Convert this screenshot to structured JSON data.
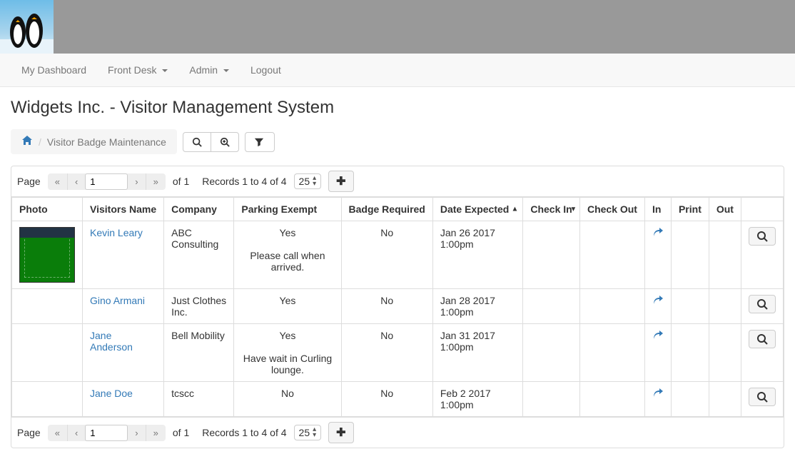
{
  "nav": {
    "items": [
      {
        "label": "My Dashboard",
        "dropdown": false
      },
      {
        "label": "Front Desk",
        "dropdown": true
      },
      {
        "label": "Admin",
        "dropdown": true
      },
      {
        "label": "Logout",
        "dropdown": false
      }
    ]
  },
  "page_title": "Widgets Inc. - Visitor Management System",
  "breadcrumb": {
    "current": "Visitor Badge Maintenance"
  },
  "pager": {
    "page_label": "Page",
    "page_value": "1",
    "of_label": "of",
    "total_pages": "1",
    "records_text": "Records 1 to 4 of 4",
    "page_size": "25"
  },
  "columns": {
    "photo": "Photo",
    "name": "Visitors Name",
    "company": "Company",
    "parking": "Parking Exempt",
    "badge": "Badge Required",
    "date": "Date Expected",
    "checkin": "Check In",
    "checkout": "Check Out",
    "in": "In",
    "print": "Print",
    "out": "Out"
  },
  "rows": [
    {
      "has_photo": true,
      "name": "Kevin Leary",
      "company": "ABC Consulting",
      "parking": "Yes",
      "parking_note": "Please call when arrived.",
      "badge": "No",
      "date": "Jan 26 2017 1:00pm"
    },
    {
      "has_photo": false,
      "name": "Gino Armani",
      "company": "Just Clothes Inc.",
      "parking": "Yes",
      "parking_note": "",
      "badge": "No",
      "date": "Jan 28 2017 1:00pm"
    },
    {
      "has_photo": false,
      "name": "Jane Anderson",
      "company": "Bell Mobility",
      "parking": "Yes",
      "parking_note": "Have wait in Curling lounge.",
      "badge": "No",
      "date": "Jan 31 2017 1:00pm"
    },
    {
      "has_photo": false,
      "name": "Jane Doe",
      "company": "tcscc",
      "parking": "No",
      "parking_note": "",
      "badge": "No",
      "date": "Feb 2 2017 1:00pm"
    }
  ]
}
